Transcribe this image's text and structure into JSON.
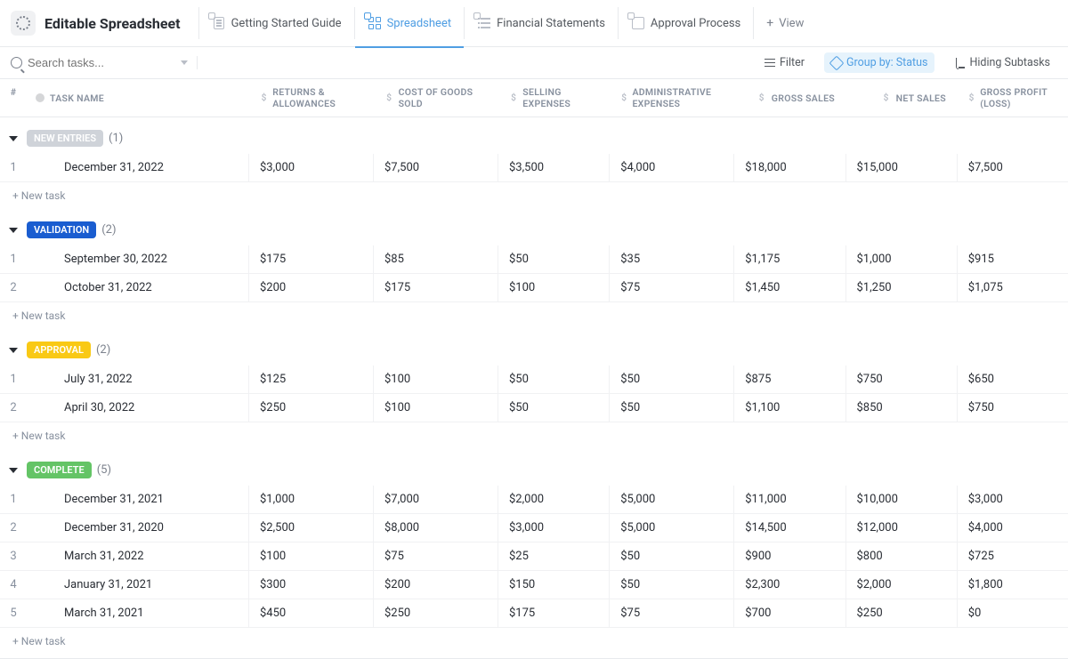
{
  "header": {
    "title": "Editable Spreadsheet",
    "tabs": [
      {
        "label": "Getting Started Guide"
      },
      {
        "label": "Spreadsheet"
      },
      {
        "label": "Financial Statements"
      },
      {
        "label": "Approval Process"
      }
    ],
    "add_view": "View"
  },
  "toolbar": {
    "search_placeholder": "Search tasks...",
    "filter": "Filter",
    "group_by": "Group by: Status",
    "subtasks": "Hiding Subtasks"
  },
  "columns": {
    "num": "#",
    "name": "TASK NAME",
    "returns": "RETURNS & ALLOWANCES",
    "cogs": "COST OF GOODS SOLD",
    "selling": "SELLING EXPENSES",
    "admin": "ADMINISTRATIVE EXPENSES",
    "gross_sales": "GROSS SALES",
    "net_sales": "NET SALES",
    "gross_profit": "GROSS PROFIT (LOSS)"
  },
  "new_task_label": "+ New task",
  "groups": [
    {
      "badge": "NEW ENTRIES",
      "badge_class": "badge-new",
      "count": "(1)",
      "rows": [
        {
          "num": "1",
          "name": "December 31, 2022",
          "returns": "$3,000",
          "cogs": "$7,500",
          "selling": "$3,500",
          "admin": "$4,000",
          "gross_sales": "$18,000",
          "net_sales": "$15,000",
          "gross_profit": "$7,500"
        }
      ]
    },
    {
      "badge": "VALIDATION",
      "badge_class": "badge-validation",
      "count": "(2)",
      "rows": [
        {
          "num": "1",
          "name": "September 30, 2022",
          "returns": "$175",
          "cogs": "$85",
          "selling": "$50",
          "admin": "$35",
          "gross_sales": "$1,175",
          "net_sales": "$1,000",
          "gross_profit": "$915"
        },
        {
          "num": "2",
          "name": "October 31, 2022",
          "returns": "$200",
          "cogs": "$175",
          "selling": "$100",
          "admin": "$75",
          "gross_sales": "$1,450",
          "net_sales": "$1,250",
          "gross_profit": "$1,075"
        }
      ]
    },
    {
      "badge": "APPROVAL",
      "badge_class": "badge-approval",
      "count": "(2)",
      "rows": [
        {
          "num": "1",
          "name": "July 31, 2022",
          "returns": "$125",
          "cogs": "$100",
          "selling": "$50",
          "admin": "$50",
          "gross_sales": "$875",
          "net_sales": "$750",
          "gross_profit": "$650"
        },
        {
          "num": "2",
          "name": "April 30, 2022",
          "returns": "$250",
          "cogs": "$100",
          "selling": "$50",
          "admin": "$50",
          "gross_sales": "$1,100",
          "net_sales": "$850",
          "gross_profit": "$750"
        }
      ]
    },
    {
      "badge": "COMPLETE",
      "badge_class": "badge-complete",
      "count": "(5)",
      "rows": [
        {
          "num": "1",
          "name": "December 31, 2021",
          "returns": "$1,000",
          "cogs": "$7,000",
          "selling": "$2,000",
          "admin": "$5,000",
          "gross_sales": "$11,000",
          "net_sales": "$10,000",
          "gross_profit": "$3,000"
        },
        {
          "num": "2",
          "name": "December 31, 2020",
          "returns": "$2,500",
          "cogs": "$8,000",
          "selling": "$3,000",
          "admin": "$5,000",
          "gross_sales": "$14,500",
          "net_sales": "$12,000",
          "gross_profit": "$4,000"
        },
        {
          "num": "3",
          "name": "March 31, 2022",
          "returns": "$100",
          "cogs": "$75",
          "selling": "$25",
          "admin": "$50",
          "gross_sales": "$900",
          "net_sales": "$800",
          "gross_profit": "$725"
        },
        {
          "num": "4",
          "name": "January 31, 2021",
          "returns": "$300",
          "cogs": "$200",
          "selling": "$150",
          "admin": "$50",
          "gross_sales": "$2,300",
          "net_sales": "$2,000",
          "gross_profit": "$1,800"
        },
        {
          "num": "5",
          "name": "March 31, 2021",
          "returns": "$450",
          "cogs": "$250",
          "selling": "$175",
          "admin": "$75",
          "gross_sales": "$700",
          "net_sales": "$250",
          "gross_profit": "$0"
        }
      ]
    }
  ]
}
